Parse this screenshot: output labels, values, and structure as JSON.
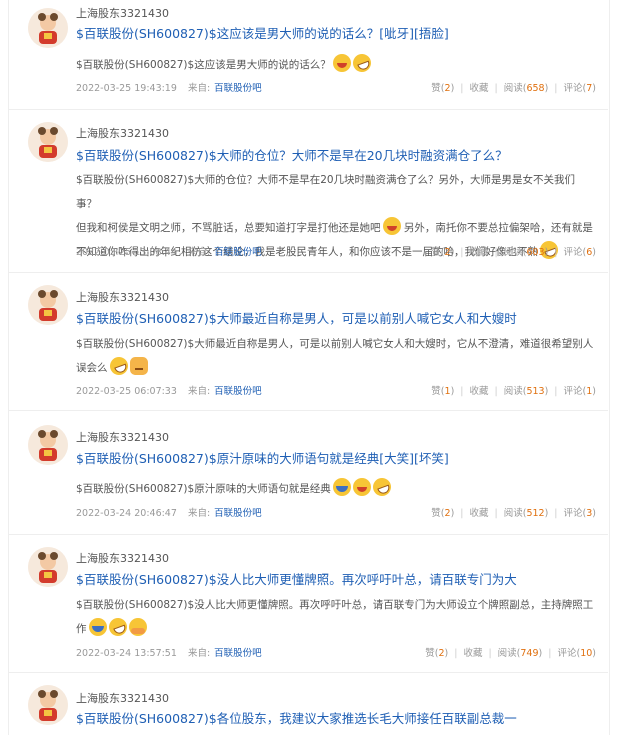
{
  "posts": [
    {
      "user": "上海股东3321430",
      "title": "$百联股份(SH600827)$这应该是男大师的说的话么？[呲牙][捂脸]",
      "body_lines": [
        "$百联股份(SH600827)$这应该是男大师的说的话么？"
      ],
      "emojis": [
        "grin-face-icon",
        "laugh-cry-face-icon"
      ],
      "time": "2022-03-25 19:43:19",
      "from_label": "来自:",
      "source": "百联股份吧",
      "likes_label": "赞",
      "likes": "2",
      "fav_label": "收藏",
      "reads_label": "阅读",
      "reads": "658",
      "comments_label": "评论",
      "comments": "7"
    },
    {
      "user": "上海股东3321430",
      "title": "$百联股份(SH600827)$大师的仓位？大师不是早在20几块时融资满仓了么？",
      "body_lines": [
        "$百联股份(SH600827)$大师的仓位？大师不是早在20几块时融资满仓了么？另外，大师是男是女不关我们事？",
        "但我和柯侯是文明之师，不骂脏话，总要知道打字是打他还是她吧",
        "另外，南托你不要总拉偏架哈，还有就是",
        "不知道你咋得出的年纪相仿这个结论，我是老股民青年人，和你应该不是一届的哈，我们好像也不熟"
      ],
      "emojis": [],
      "time": "2022-03-25 13:08:44",
      "from_label": "来自:",
      "source": "百联股份吧",
      "likes_label": "赞",
      "likes": "2",
      "fav_label": "收藏",
      "reads_label": "阅读",
      "reads": "603",
      "comments_label": "评论",
      "comments": "6"
    },
    {
      "user": "上海股东3321430",
      "title": "$百联股份(SH600827)$大师最近自称是男人，可是以前别人喊它女人和大嫂时",
      "body_lines": [
        "$百联股份(SH600827)$大师最近自称是男人，可是以前别人喊它女人和大嫂时，它从不澄清，难道很希望别人",
        "误会么"
      ],
      "emojis": [
        "laugh-cry-face-icon",
        "cat-face-icon"
      ],
      "time": "2022-03-25 06:07:33",
      "from_label": "来自:",
      "source": "百联股份吧",
      "likes_label": "赞",
      "likes": "1",
      "fav_label": "收藏",
      "reads_label": "阅读",
      "reads": "513",
      "comments_label": "评论",
      "comments": "1"
    },
    {
      "user": "上海股东3321430",
      "title": "$百联股份(SH600827)$原汁原味的大师语句就是经典[大笑][坏笑]",
      "body_lines": [
        "$百联股份(SH600827)$原汁原味的大师语句就是经典"
      ],
      "emojis": [
        "laugh-face-icon",
        "grin-face-icon",
        "laugh-cry-face-icon"
      ],
      "time": "2022-03-24 20:46:47",
      "from_label": "来自:",
      "source": "百联股份吧",
      "likes_label": "赞",
      "likes": "2",
      "fav_label": "收藏",
      "reads_label": "阅读",
      "reads": "512",
      "comments_label": "评论",
      "comments": "3"
    },
    {
      "user": "上海股东3321430",
      "title": "$百联股份(SH600827)$没人比大师更懂牌照。再次呼吁叶总，请百联专门为大",
      "body_lines": [
        "$百联股份(SH600827)$没人比大师更懂牌照。再次呼吁叶总，请百联专门为大师设立个牌照副总，主持牌照工",
        "作"
      ],
      "emojis": [
        "laugh-face-icon",
        "laugh-cry-face-icon",
        "rub-face-icon"
      ],
      "time": "2022-03-24 13:57:51",
      "from_label": "来自:",
      "source": "百联股份吧",
      "likes_label": "赞",
      "likes": "2",
      "fav_label": "收藏",
      "reads_label": "阅读",
      "reads": "749",
      "comments_label": "评论",
      "comments": "10"
    },
    {
      "user": "上海股东3321430",
      "title": "$百联股份(SH600827)$各位股东，我建议大家推选长毛大师接任百联副总裁一"
    }
  ]
}
